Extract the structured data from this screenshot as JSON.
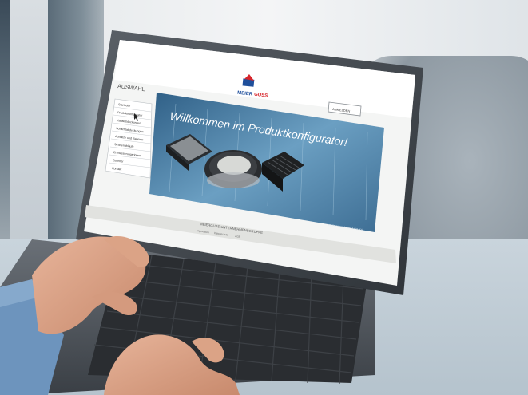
{
  "scene": {
    "description_role": "photo",
    "colors": {
      "laptop_body": "#4a4f55",
      "screen_bg": "#ffffff",
      "banner": "#5d8fb2",
      "brand_blue": "#1f4f9b",
      "brand_red": "#d6252b",
      "sleeve": "#6d94bd",
      "skin": "#d9a287"
    }
  },
  "site": {
    "brand_meier": "MEIER",
    "brand_guss": "GUSS",
    "sidebar_title": "AUSWAHL",
    "top_button": "ANMELDEN",
    "sidebar_items": [
      "Startseite",
      "Produktkonfigurator",
      "Kanalabdeckungen",
      "Schachtabdeckungen",
      "Aufsätze und Rahmen",
      "Straßenabläufe",
      "Entwässerungsrinnen",
      "Zubehör",
      "Kontakt"
    ],
    "banner_text": "Willkommen im Produktkonfigurator!",
    "banner_caption": "MEIERGUSS GMBH & CO. KG",
    "footer_title": "MEIERGUSS-UNTERNEHMENSGRUPPE",
    "footer_links": [
      "Impressum",
      "Datenschutz",
      "AGB"
    ]
  }
}
